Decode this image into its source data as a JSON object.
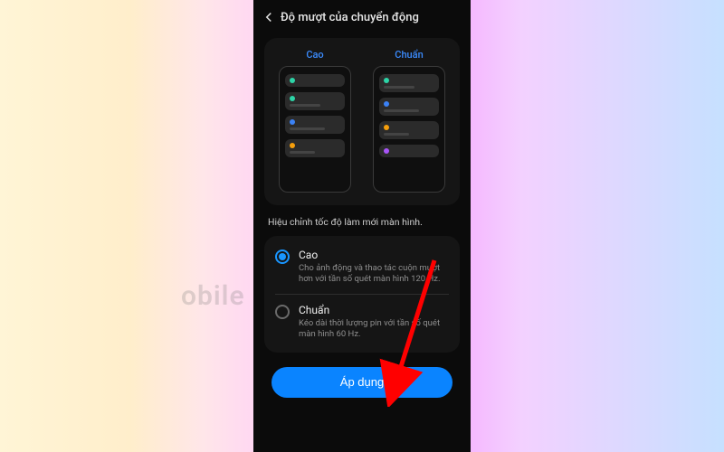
{
  "header": {
    "title": "Độ mượt của chuyển động"
  },
  "previews": {
    "high_label": "Cao",
    "standard_label": "Chuẩn"
  },
  "description": "Hiệu chỉnh tốc độ làm mới màn hình.",
  "options": {
    "high": {
      "label": "Cao",
      "desc": "Cho ảnh động và thao tác cuộn mượt hơn với tần số quét màn hình 120 Hz.",
      "selected": true
    },
    "standard": {
      "label": "Chuẩn",
      "desc": "Kéo dài thời lượng pin với tần số quét màn hình 60 Hz.",
      "selected": false
    }
  },
  "apply_button": "Áp dụng",
  "watermark": "obile"
}
